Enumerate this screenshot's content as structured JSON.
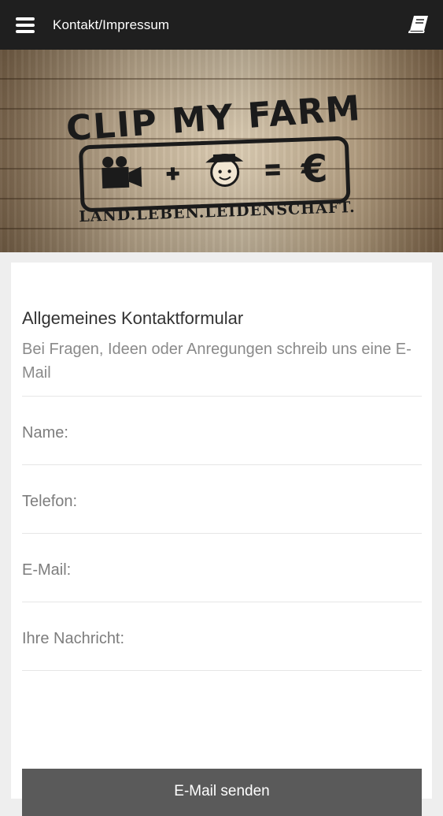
{
  "header": {
    "title": "Kontakt/Impressum",
    "menu_icon": "hamburger-menu-icon",
    "book_icon": "book-icon"
  },
  "hero": {
    "logo_title": "CLIP MY FARM",
    "logo_slogan": "LAND.LEBEN.LEIDENSCHAFT.",
    "logo_symbols": [
      "camera-icon",
      "+",
      "farmer-face-icon",
      "=",
      "€"
    ]
  },
  "form": {
    "title": "Allgemeines Kontaktformular",
    "subtitle": "Bei Fragen, Ideen oder Anregungen schreib uns eine E-Mail",
    "fields": [
      {
        "placeholder": "Name:"
      },
      {
        "placeholder": "Telefon:"
      },
      {
        "placeholder": "E-Mail:"
      },
      {
        "placeholder": "Ihre Nachricht:"
      }
    ],
    "submit_label": "E-Mail senden"
  },
  "colors": {
    "topbar": "#1f1f1f",
    "background": "#eeeeee",
    "button": "#5a5a5a"
  }
}
